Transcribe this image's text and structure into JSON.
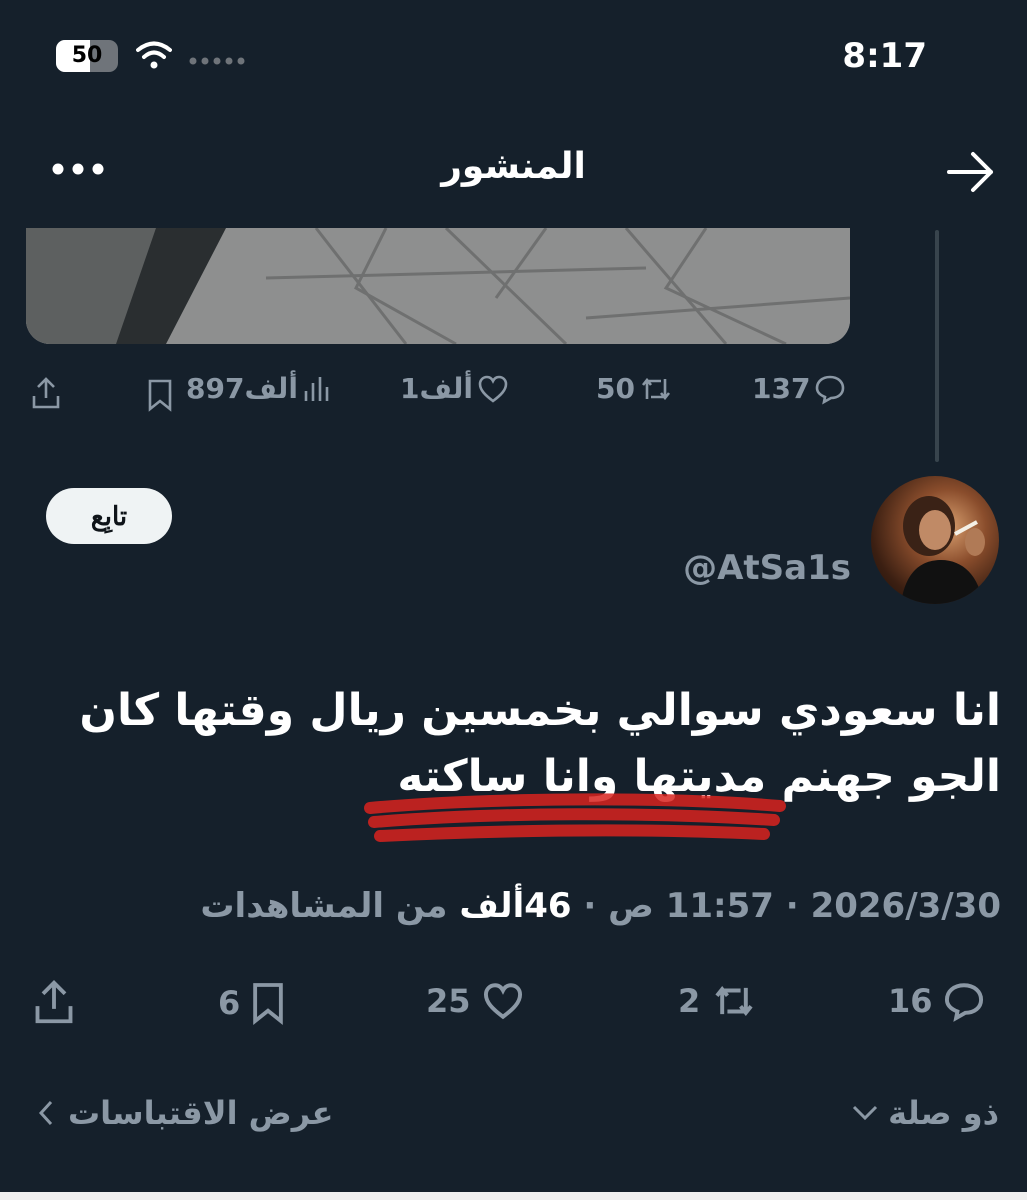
{
  "status_bar": {
    "battery": "50",
    "time": "8:17"
  },
  "header": {
    "title": "المنشور"
  },
  "previous_post": {
    "replies": "137",
    "reposts": "50",
    "likes": "1ألف",
    "views": "897ألف"
  },
  "author": {
    "handle": "@AtSa1s",
    "follow_label": "تابِع"
  },
  "tweet": {
    "text": "انا سعودي سوالي بخمسين ريال وقتها كان الجو جهنم مديتها وانا ساكته",
    "date_time": "2026/3/30 · 11:57 ص · ",
    "views_count": "46ألف",
    "views_suffix": " من المشاهدات"
  },
  "actions": {
    "replies": "16",
    "reposts": "2",
    "likes": "25",
    "bookmarks": "6"
  },
  "footer": {
    "related_label": "ذو صلة",
    "quotes_label": "عرض الاقتباسات"
  }
}
